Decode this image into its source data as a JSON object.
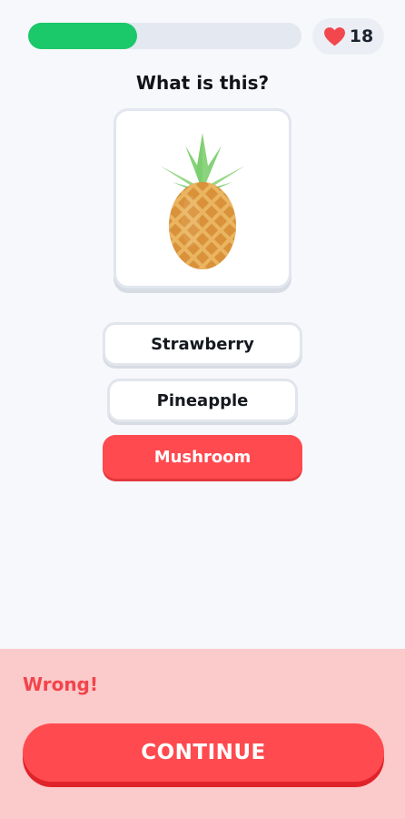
{
  "progress": {
    "fraction": 0.4,
    "color": "#1bc86a",
    "track_color": "#e4e8f1"
  },
  "hearts": {
    "count": "18",
    "icon": "heart-icon",
    "color": "#f2474d"
  },
  "question": {
    "text": "What is this?",
    "image_icon": "pineapple-icon"
  },
  "options": [
    {
      "label": "Strawberry",
      "state": "default"
    },
    {
      "label": "Pineapple",
      "state": "default"
    },
    {
      "label": "Mushroom",
      "state": "wrong"
    }
  ],
  "feedback": {
    "status_text": "Wrong!",
    "continue_label": "CONTINUE",
    "panel_color": "#fbcacb",
    "accent_color": "#ff4a4f"
  }
}
